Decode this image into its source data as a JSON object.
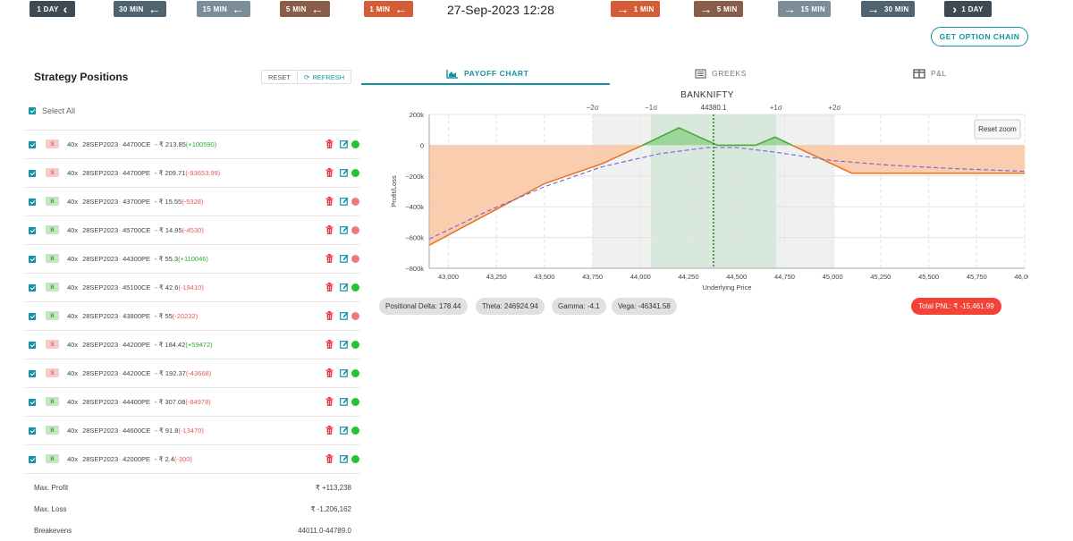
{
  "nav": {
    "back": [
      {
        "label": "1 DAY",
        "color": "#3d4a54"
      },
      {
        "label": "30 MIN",
        "color": "#4f6470"
      },
      {
        "label": "15 MIN",
        "color": "#7b8d98"
      },
      {
        "label": "5 MIN",
        "color": "#8a5d4b"
      },
      {
        "label": "1 MIN",
        "color": "#d45d38"
      }
    ],
    "forward": [
      {
        "label": "1 MIN",
        "color": "#d45d38"
      },
      {
        "label": "5 MIN",
        "color": "#8a5d4b"
      },
      {
        "label": "15 MIN",
        "color": "#7b8d98"
      },
      {
        "label": "30 MIN",
        "color": "#4f6470"
      },
      {
        "label": "1 DAY",
        "color": "#3d4a54"
      }
    ],
    "datetime": "27-Sep-2023 12:28",
    "get_option_chain": "GET OPTION CHAIN"
  },
  "left": {
    "title": "Strategy Positions",
    "reset": "RESET",
    "refresh": "REFRESH",
    "select_all": "Select All",
    "positions": [
      {
        "side": "S",
        "qty": "40x",
        "expiry": "28SEP2023",
        "instrument": "44700CE",
        "price": "- ₹ 213.85",
        "pnl": "(+100590)",
        "pnl_sign": "pos",
        "status": "green"
      },
      {
        "side": "S",
        "qty": "40x",
        "expiry": "28SEP2023",
        "instrument": "44700PE",
        "price": "- ₹ 209.71",
        "pnl": "(-93653.99)",
        "pnl_sign": "neg",
        "status": "green"
      },
      {
        "side": "B",
        "qty": "40x",
        "expiry": "28SEP2023",
        "instrument": "43700PE",
        "price": "- ₹ 15.55",
        "pnl": "(-5328)",
        "pnl_sign": "neg",
        "status": "red"
      },
      {
        "side": "B",
        "qty": "40x",
        "expiry": "28SEP2023",
        "instrument": "45700CE",
        "price": "- ₹ 14.95",
        "pnl": "(-4530)",
        "pnl_sign": "neg",
        "status": "red"
      },
      {
        "side": "B",
        "qty": "40x",
        "expiry": "28SEP2023",
        "instrument": "44300PE",
        "price": "- ₹ 55.3",
        "pnl": "(+110046)",
        "pnl_sign": "pos",
        "status": "red"
      },
      {
        "side": "B",
        "qty": "40x",
        "expiry": "28SEP2023",
        "instrument": "45100CE",
        "price": "- ₹ 42.6",
        "pnl": "(-19410)",
        "pnl_sign": "neg",
        "status": "green"
      },
      {
        "side": "B",
        "qty": "40x",
        "expiry": "28SEP2023",
        "instrument": "43800PE",
        "price": "- ₹ 55",
        "pnl": "(-20232)",
        "pnl_sign": "neg",
        "status": "red"
      },
      {
        "side": "S",
        "qty": "40x",
        "expiry": "28SEP2023",
        "instrument": "44200PE",
        "price": "- ₹ 184.42",
        "pnl": "(+59472)",
        "pnl_sign": "pos",
        "status": "green"
      },
      {
        "side": "S",
        "qty": "40x",
        "expiry": "28SEP2023",
        "instrument": "44200CE",
        "price": "- ₹ 192.37",
        "pnl": "(-43668)",
        "pnl_sign": "neg",
        "status": "green"
      },
      {
        "side": "B",
        "qty": "40x",
        "expiry": "28SEP2023",
        "instrument": "44400PE",
        "price": "- ₹ 307.08",
        "pnl": "(-84978)",
        "pnl_sign": "neg",
        "status": "green"
      },
      {
        "side": "B",
        "qty": "40x",
        "expiry": "28SEP2023",
        "instrument": "44600CE",
        "price": "- ₹ 91.8",
        "pnl": "(-13470)",
        "pnl_sign": "neg",
        "status": "green"
      },
      {
        "side": "B",
        "qty": "40x",
        "expiry": "28SEP2023",
        "instrument": "42000PE",
        "price": "- ₹ 2.4",
        "pnl": "(-300)",
        "pnl_sign": "neg",
        "status": "green"
      }
    ],
    "summary": [
      {
        "label": "Max. Profit",
        "value": "₹ +113,238"
      },
      {
        "label": "Max. Loss",
        "value": "₹ -1,206,162"
      },
      {
        "label": "Breakevens",
        "value": "44011.0-44789.0"
      }
    ]
  },
  "tabs": [
    {
      "label": "PAYOFF CHART",
      "icon": "area-chart-icon",
      "active": true
    },
    {
      "label": "GREEKS",
      "icon": "newspaper-icon",
      "active": false
    },
    {
      "label": "P&L",
      "icon": "table-icon",
      "active": false
    }
  ],
  "greeks": {
    "delta": "Positional Delta: 178.44",
    "theta": "Theta: 246924.94",
    "gamma": "Gamma: -4.1",
    "vega": "Vega: -46341.58",
    "total_pnl": "Total PNL: ₹ -15,461.99"
  },
  "chart_data": {
    "type": "area",
    "title": "BANKNIFTY",
    "xlabel": "Underlying Price",
    "ylabel": "Profit/Loss",
    "xlim": [
      42900,
      46000
    ],
    "ylim": [
      -800000,
      200000
    ],
    "xticks": [
      43000,
      43250,
      43500,
      43750,
      44000,
      44250,
      44500,
      44750,
      45000,
      45250,
      45500,
      45750,
      46000
    ],
    "xtick_labels": [
      "43,000",
      "43,250",
      "43,500",
      "43,750",
      "44,000",
      "44,250",
      "44,500",
      "44,750",
      "45,000",
      "45,250",
      "45,500",
      "45,750",
      "46,000"
    ],
    "yticks": [
      200000,
      0,
      -200000,
      -400000,
      -600000,
      -800000
    ],
    "ytick_labels": [
      "200k",
      "0",
      "−200k",
      "−400k",
      "−600k",
      "−800k"
    ],
    "spot": 44380.1,
    "spot_label": "44380.1",
    "sigma_bands": [
      {
        "label": "−2σ",
        "x": 43750
      },
      {
        "label": "−1σ",
        "x": 44055
      },
      {
        "label": "+1σ",
        "x": 44705
      },
      {
        "label": "+2σ",
        "x": 45010
      }
    ],
    "band1": [
      44055,
      44705
    ],
    "band2": [
      43750,
      45010
    ],
    "series": [
      {
        "kind": "expiry",
        "x": [
          42900,
          43200,
          43500,
          43800,
          44011,
          44200,
          44400,
          44500,
          44600,
          44700,
          44789,
          45100,
          46000
        ],
        "values": [
          -650000,
          -450000,
          -250000,
          -120000,
          0,
          113238,
          0,
          0,
          0,
          53000,
          0,
          -182000,
          -182000
        ]
      },
      {
        "kind": "today",
        "x": [
          42900,
          43200,
          43500,
          43800,
          44100,
          44350,
          44500,
          44700,
          45000,
          45300,
          45600,
          46000
        ],
        "values": [
          -610000,
          -430000,
          -270000,
          -140000,
          -55000,
          -15000,
          -15000,
          -45000,
          -100000,
          -130000,
          -150000,
          -170000
        ]
      }
    ],
    "reset_zoom": "Reset zoom",
    "grid": true
  }
}
